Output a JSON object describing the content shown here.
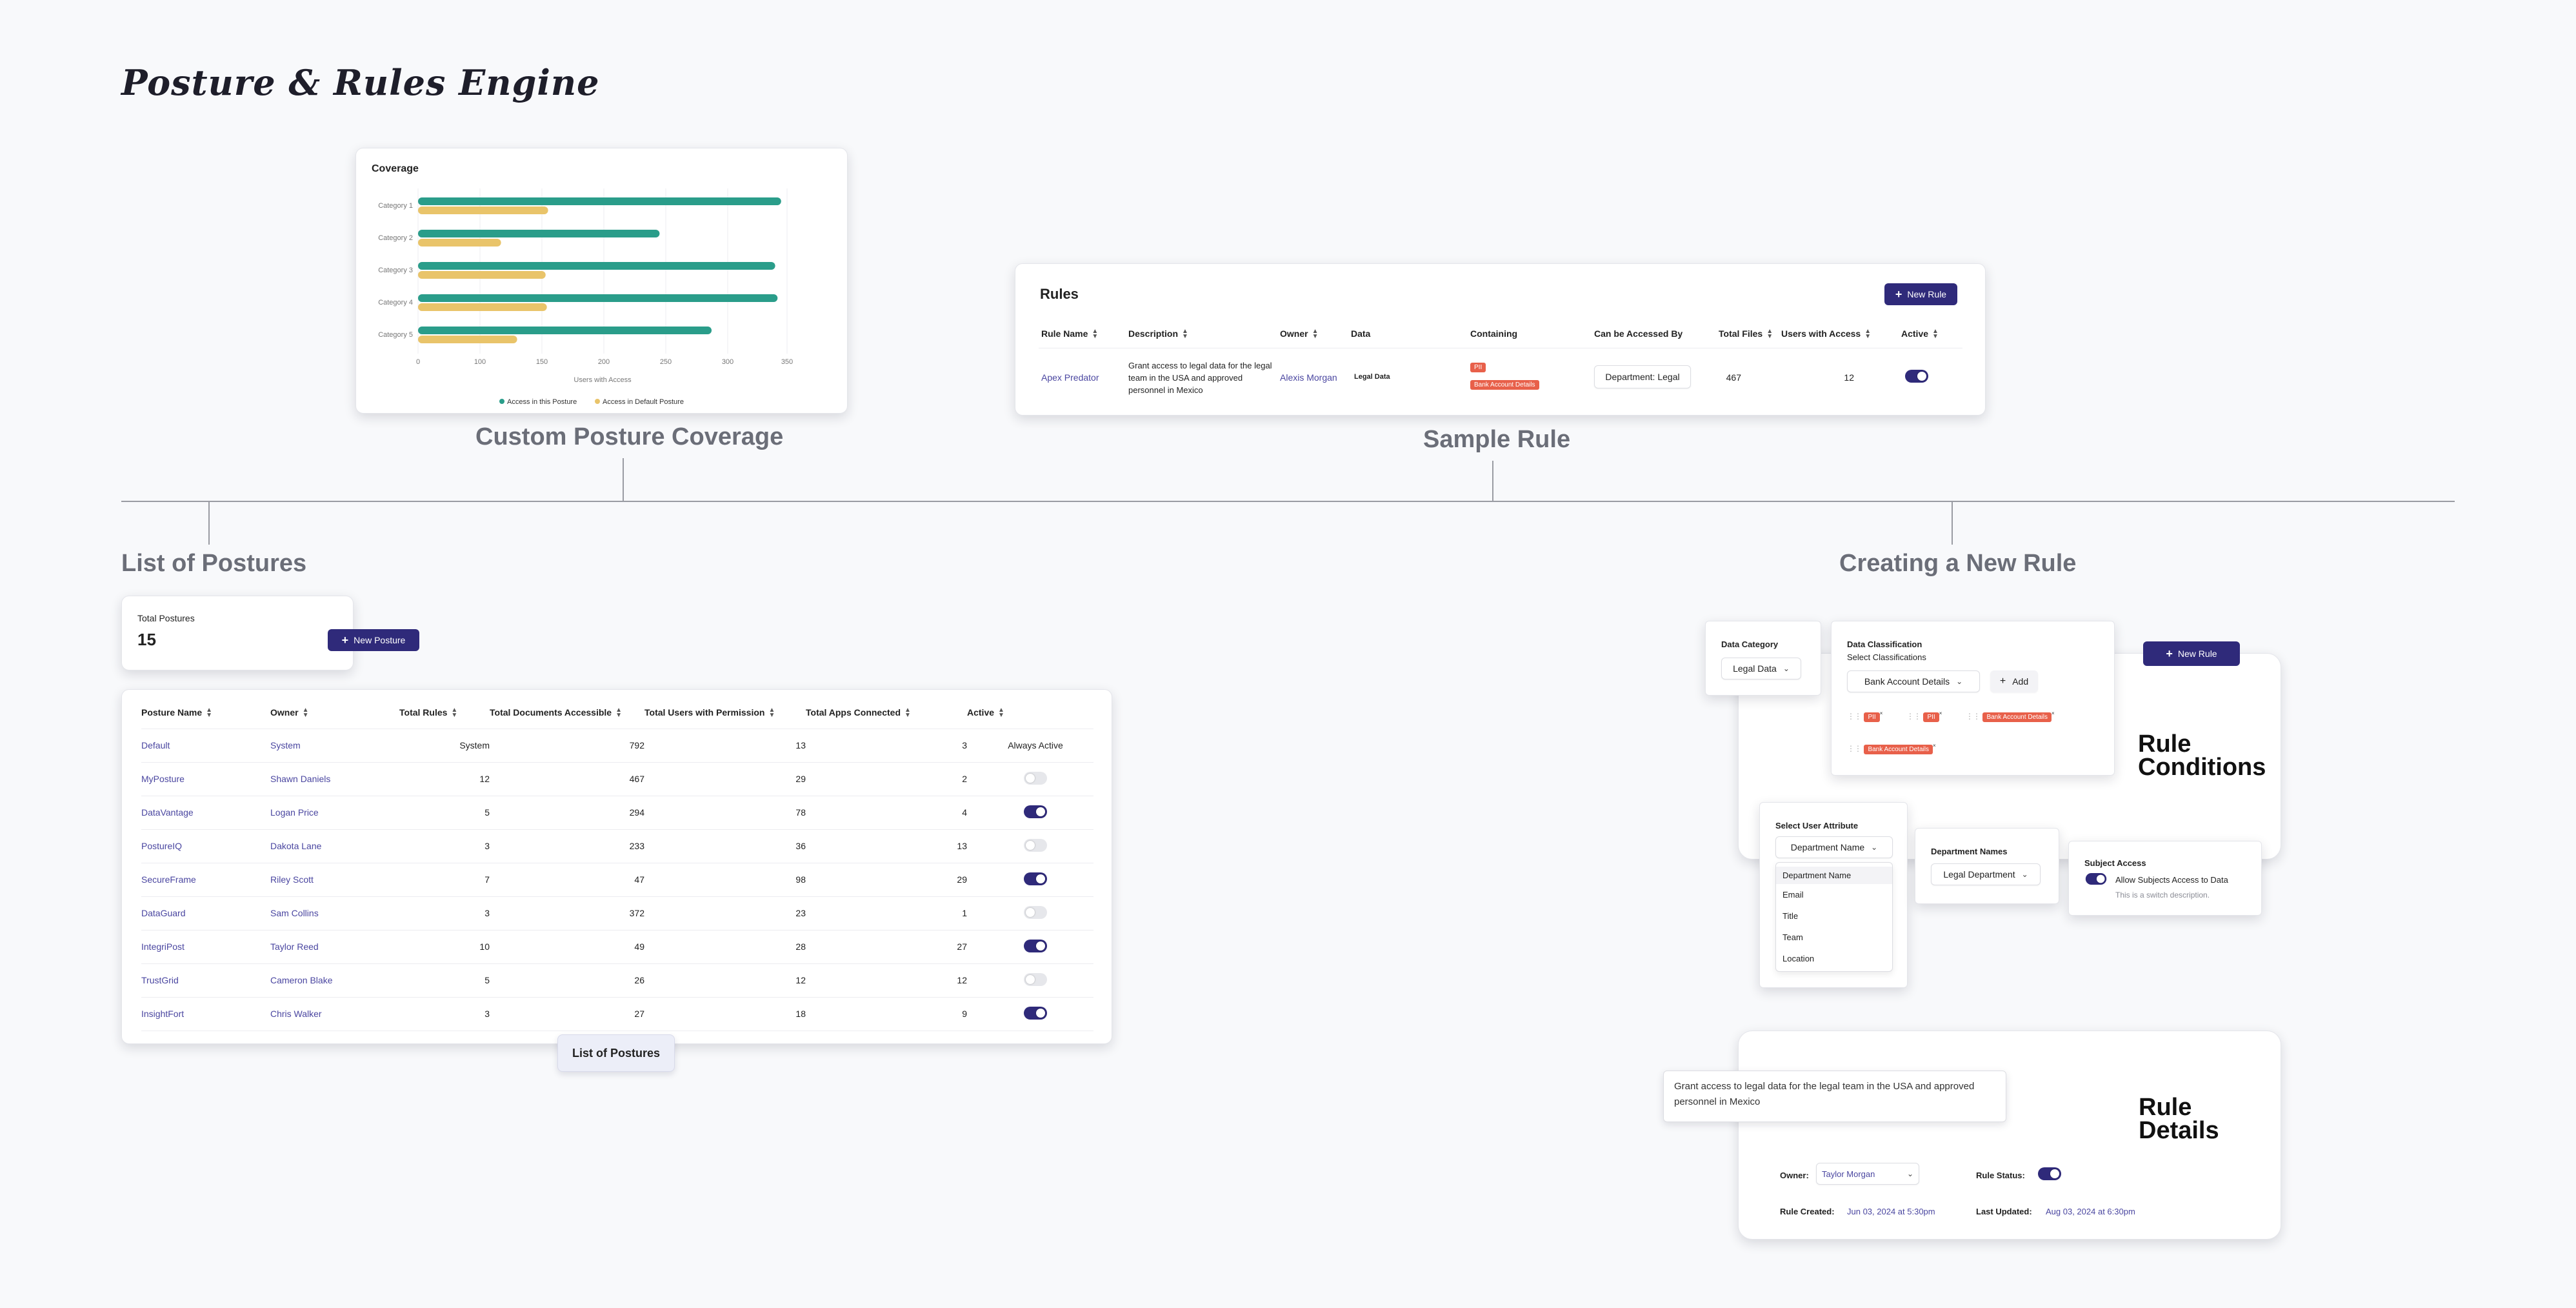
{
  "page": {
    "title": "Posture & Rules Engine",
    "labels": {
      "coverage": "Custom Posture Coverage",
      "sample_rule": "Sample Rule",
      "list_postures": "List of Postures",
      "creating_rule": "Creating a New Rule"
    }
  },
  "coverage_chart": {
    "chart_data": {
      "type": "bar",
      "orientation": "horizontal",
      "title": "Coverage",
      "categories": [
        "Category 1",
        "Category 2",
        "Category 3",
        "Category 4",
        "Category 5"
      ],
      "series": [
        {
          "name": "Access in this Posture",
          "color": "#2a9d8a",
          "values": [
            345,
            245,
            340,
            342,
            287
          ]
        },
        {
          "name": "Access in Default Posture",
          "color": "#e9c46a",
          "values": [
            155,
            117,
            153,
            154,
            130
          ]
        }
      ],
      "xlabel": "Users with Access",
      "xlim": [
        0,
        350
      ],
      "xticks": [
        "0",
        "100",
        "150",
        "200",
        "250",
        "300",
        "350"
      ],
      "legend": "bottom"
    }
  },
  "rules_card": {
    "title": "Rules",
    "new_rule_button": "New Rule",
    "columns": [
      "Rule Name",
      "Description",
      "Owner",
      "Data",
      "Containing",
      "Can be Accessed By",
      "Total Files",
      "Users with Access",
      "Active"
    ],
    "row": {
      "name": "Apex Predator",
      "description": "Grant access to legal data for the legal team in the USA and approved personnel in Mexico",
      "owner": "Alexis Morgan",
      "data": "Legal Data",
      "tags": [
        "PII",
        "Bank Account Details"
      ],
      "accessed_by": "Department: Legal",
      "total_files": "467",
      "users": "12",
      "active": true
    }
  },
  "postures": {
    "total_label": "Total Postures",
    "total": "15",
    "new_button": "New Posture",
    "tooltip": "List of Postures",
    "columns": [
      "Posture Name",
      "Owner",
      "Total Rules",
      "Total Documents Accessible",
      "Total Users with Permission",
      "Total Apps Connected",
      "Active"
    ],
    "rows": [
      {
        "name": "Default",
        "owner": "System",
        "rules": "System",
        "docs": "792",
        "users": "13",
        "apps": "3",
        "active_text": "Always Active"
      },
      {
        "name": "MyPosture",
        "owner": "Shawn Daniels",
        "rules": "12",
        "docs": "467",
        "users": "29",
        "apps": "2",
        "active": false
      },
      {
        "name": "DataVantage",
        "owner": "Logan Price",
        "rules": "5",
        "docs": "294",
        "users": "78",
        "apps": "4",
        "active": true
      },
      {
        "name": "PostureIQ",
        "owner": "Dakota Lane",
        "rules": "3",
        "docs": "233",
        "users": "36",
        "apps": "13",
        "active": false
      },
      {
        "name": "SecureFrame",
        "owner": "Riley Scott",
        "rules": "7",
        "docs": "47",
        "users": "98",
        "apps": "29",
        "active": true
      },
      {
        "name": "DataGuard",
        "owner": "Sam Collins",
        "rules": "3",
        "docs": "372",
        "users": "23",
        "apps": "1",
        "active": false
      },
      {
        "name": "IntegriPost",
        "owner": "Taylor Reed",
        "rules": "10",
        "docs": "49",
        "users": "28",
        "apps": "27",
        "active": true
      },
      {
        "name": "TrustGrid",
        "owner": "Cameron Blake",
        "rules": "5",
        "docs": "26",
        "users": "12",
        "apps": "12",
        "active": false
      },
      {
        "name": "InsightFort",
        "owner": "Chris Walker",
        "rules": "3",
        "docs": "27",
        "users": "18",
        "apps": "9",
        "active": true
      }
    ]
  },
  "new_rule": {
    "conditions_heading": "Rule Conditions",
    "new_rule_button": "New Rule",
    "data_category": {
      "label": "Data Category",
      "value": "Legal Data"
    },
    "data_classification": {
      "label": "Data Classification",
      "sub": "Select Classifications",
      "value": "Bank Account Details",
      "add": "Add",
      "chips": [
        "PII",
        "PII",
        "Bank Account Details",
        "Bank Account Details"
      ]
    },
    "user_attribute": {
      "label": "Select User Attribute",
      "value": "Department Name",
      "options": [
        "Department Name",
        "Email",
        "Title",
        "Team",
        "Location"
      ]
    },
    "department_names": {
      "label": "Department Names",
      "value": "Legal Department"
    },
    "subject_access": {
      "label": "Subject Access",
      "toggle_label": "Allow Subjects Access to Data",
      "description": "This is a switch description."
    },
    "details_heading": "Rule Details",
    "description": "Grant access to legal data for the legal team in the USA and approved personnel in Mexico",
    "owner_label": "Owner:",
    "owner": "Taylor Morgan",
    "status_label": "Rule Status:",
    "created_label": "Rule Created:",
    "created": "Jun 03, 2024 at 5:30pm",
    "updated_label": "Last Updated:",
    "updated": "Aug 03, 2024 at 6:30pm"
  }
}
